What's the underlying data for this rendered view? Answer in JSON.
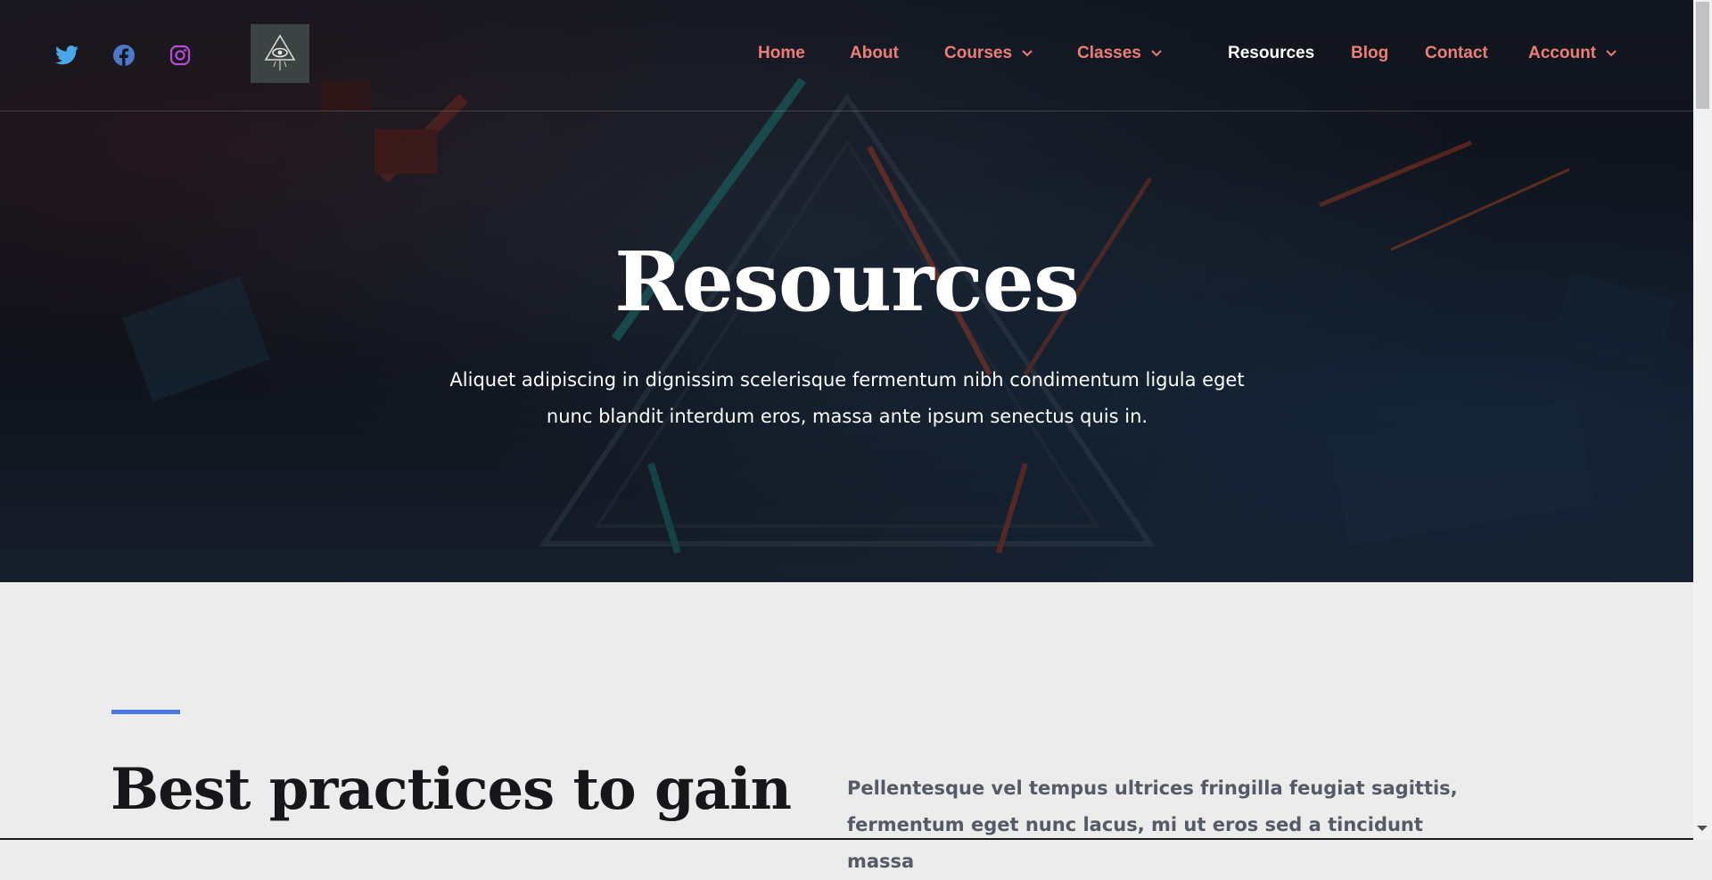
{
  "colors": {
    "nav_link": "#ec7e78",
    "nav_active": "#ffffff",
    "accent": "#4a78e0",
    "twitter": "#1d9bf0",
    "facebook": "#3b6ccf",
    "instagram": "#b04fd4"
  },
  "social": [
    {
      "name": "twitter",
      "icon": "twitter-icon"
    },
    {
      "name": "facebook",
      "icon": "facebook-icon"
    },
    {
      "name": "instagram",
      "icon": "instagram-icon"
    }
  ],
  "nav": {
    "home": "Home",
    "about": "About",
    "courses": "Courses",
    "classes": "Classes",
    "resources": "Resources",
    "blog": "Blog",
    "contact": "Contact",
    "account": "Account",
    "active": "Resources"
  },
  "hero": {
    "title": "Resources",
    "text": "Aliquet adipiscing in dignissim scelerisque fermentum nibh condimentum ligula eget nunc blandit interdum eros, massa ante ipsum senectus quis in."
  },
  "section": {
    "title": "Best practices to gain",
    "text": "Pellentesque vel tempus ultrices fringilla feugiat sagittis, fermentum eget nunc lacus, mi ut eros sed a tincidunt massa"
  }
}
